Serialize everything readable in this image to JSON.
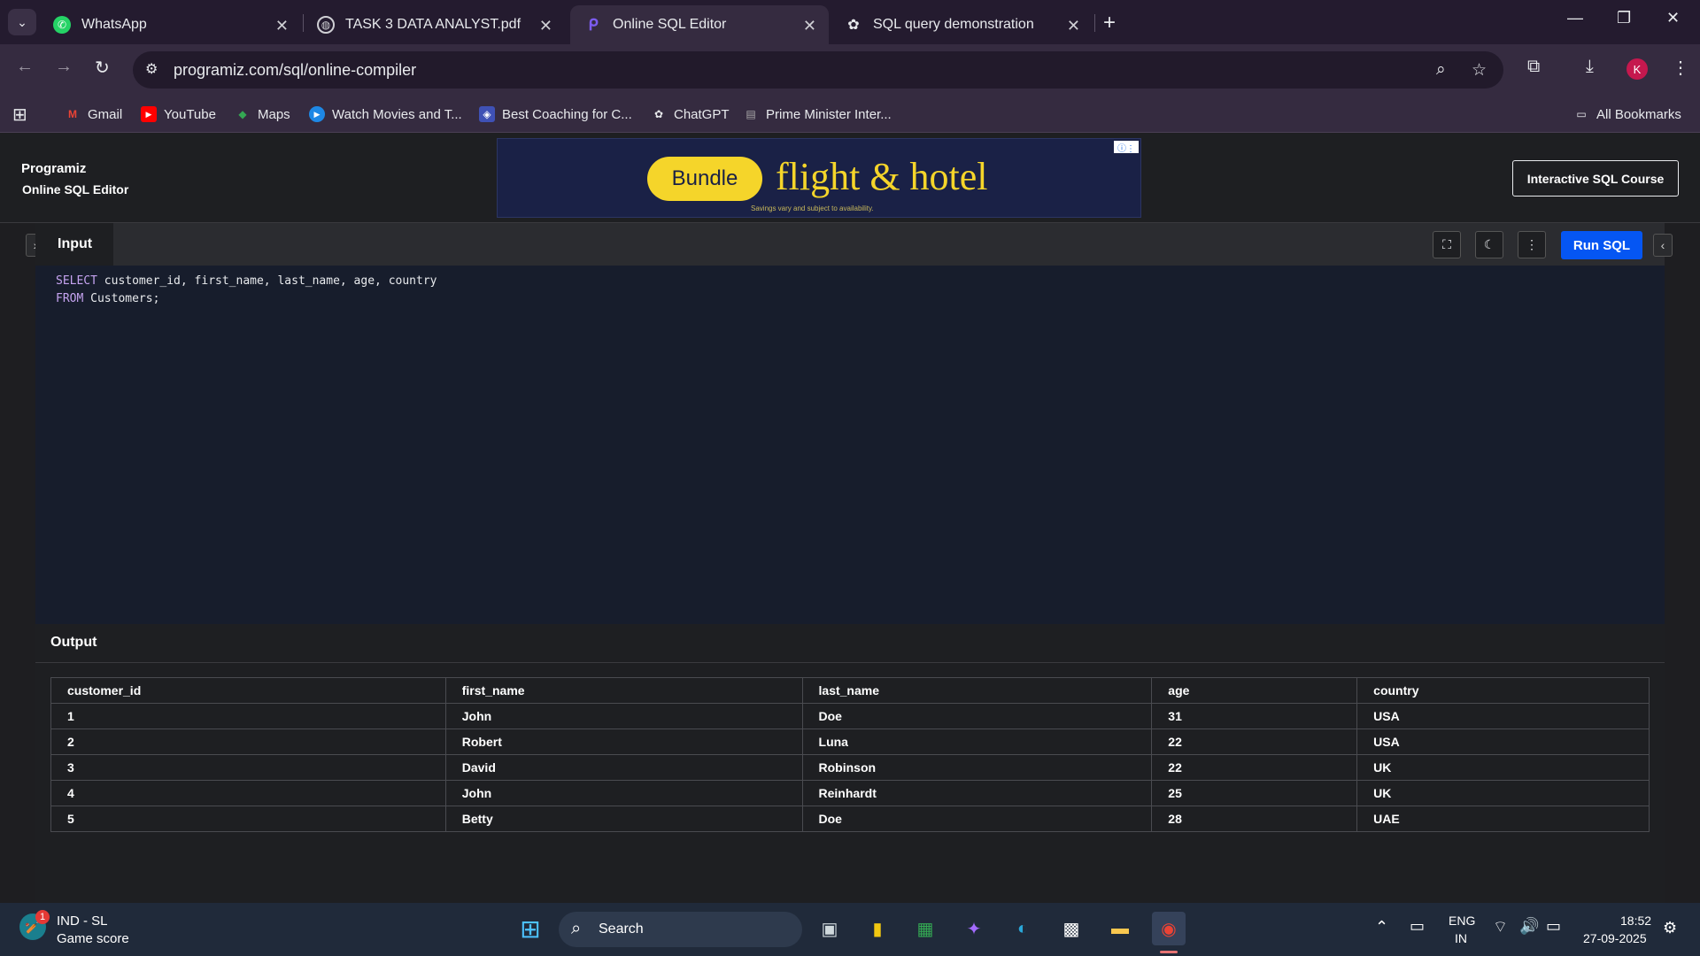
{
  "tabs": [
    {
      "label": "WhatsApp",
      "icon": "whatsapp-icon"
    },
    {
      "label": "TASK 3 DATA ANALYST.pdf",
      "icon": "globe-icon"
    },
    {
      "label": "Online SQL Editor",
      "icon": "programiz-icon"
    },
    {
      "label": "SQL query demonstration",
      "icon": "openai-icon"
    }
  ],
  "address": {
    "url": "programiz.com/sql/online-compiler"
  },
  "profile_initial": "K",
  "bookmarks": [
    {
      "label": "Gmail"
    },
    {
      "label": "YouTube"
    },
    {
      "label": "Maps"
    },
    {
      "label": "Watch Movies and T..."
    },
    {
      "label": "Best Coaching for C..."
    },
    {
      "label": "ChatGPT"
    },
    {
      "label": "Prime Minister Inter..."
    }
  ],
  "all_bookmarks": "All Bookmarks",
  "site": {
    "logo": "Programiz",
    "subtitle": "Online SQL Editor",
    "course_button": "Interactive SQL Course"
  },
  "ad": {
    "bundle": "Bundle",
    "headline": "flight & hotel",
    "fine_print": "Savings vary and subject to availability."
  },
  "editor": {
    "input_label": "Input",
    "run_label": "Run SQL",
    "line1_kw": "SELECT",
    "line1_rest": " customer_id, first_name, last_name, age, country",
    "line2_kw": "FROM",
    "line2_rest": " Customers;"
  },
  "output": {
    "label": "Output",
    "columns": [
      "customer_id",
      "first_name",
      "last_name",
      "age",
      "country"
    ],
    "rows": [
      [
        "1",
        "John",
        "Doe",
        "31",
        "USA"
      ],
      [
        "2",
        "Robert",
        "Luna",
        "22",
        "USA"
      ],
      [
        "3",
        "David",
        "Robinson",
        "22",
        "UK"
      ],
      [
        "4",
        "John",
        "Reinhardt",
        "25",
        "UK"
      ],
      [
        "5",
        "Betty",
        "Doe",
        "28",
        "UAE"
      ]
    ]
  },
  "taskbar": {
    "widget_title": "IND - SL",
    "widget_sub": "Game score",
    "widget_badge": "1",
    "search": "Search",
    "lang1": "ENG",
    "lang2": "IN",
    "time": "18:52",
    "date": "27-09-2025"
  }
}
